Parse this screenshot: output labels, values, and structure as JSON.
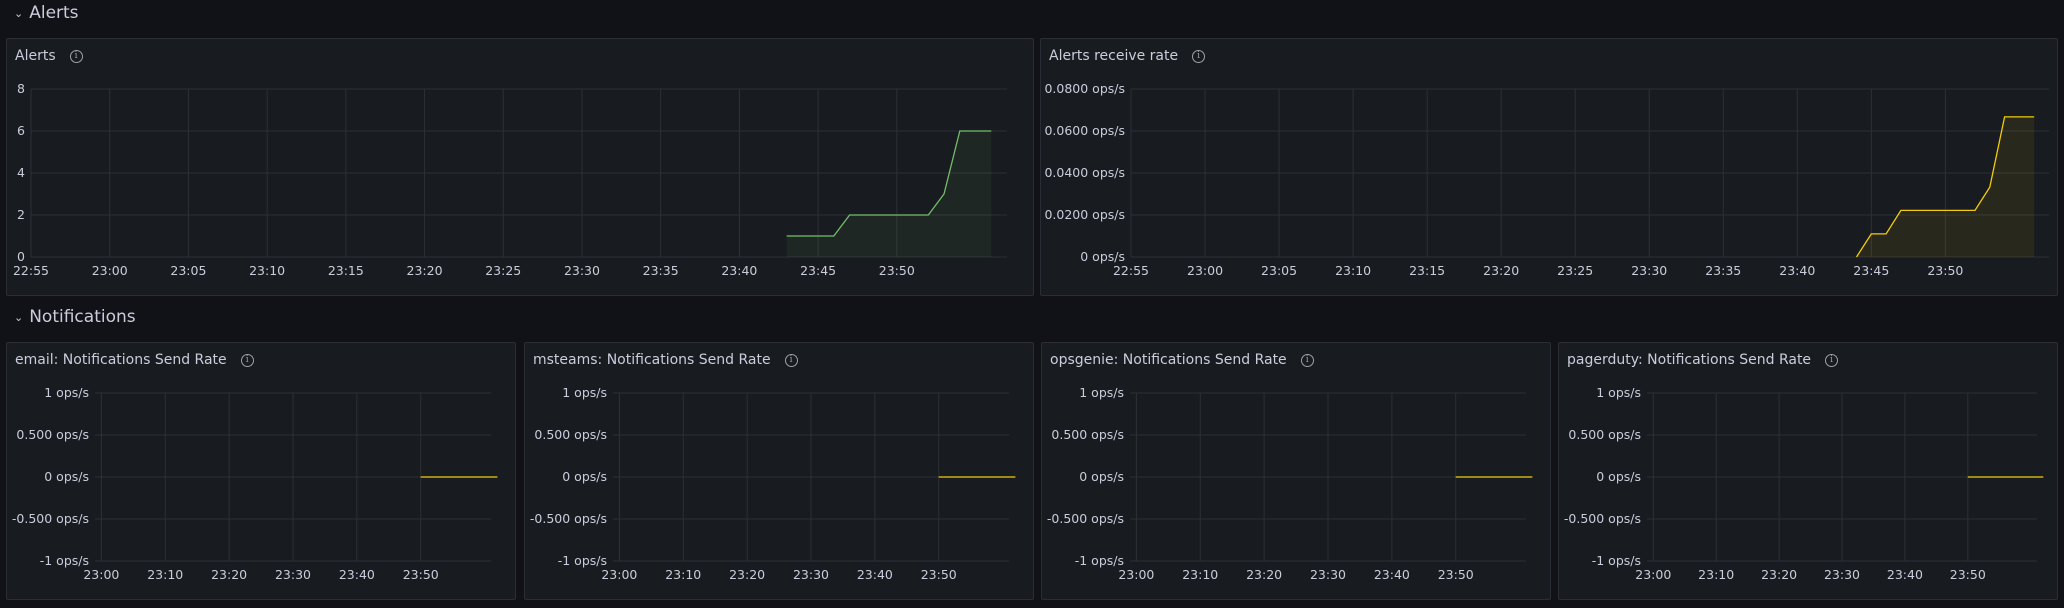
{
  "rows": {
    "alerts": {
      "label": "Alerts"
    },
    "notifications": {
      "label": "Notifications"
    }
  },
  "colors": {
    "green": "#73bf69",
    "yellow": "#f2cc0c",
    "grid": "#2d3038"
  },
  "panels": {
    "alerts": {
      "title": "Alerts",
      "chart_data": {
        "type": "area",
        "title": "Alerts",
        "y_ticks": [
          "0",
          "2",
          "4",
          "6",
          "8"
        ],
        "x_ticks": [
          "22:55",
          "23:00",
          "23:05",
          "23:10",
          "23:15",
          "23:20",
          "23:25",
          "23:30",
          "23:35",
          "23:40",
          "23:45",
          "23:50"
        ],
        "ylim": [
          0,
          8
        ],
        "series": [
          {
            "x": [
              "23:41",
              "23:42",
              "23:43",
              "23:44",
              "23:45",
              "23:46",
              "23:47",
              "23:48",
              "23:49",
              "23:50",
              "23:51",
              "23:52",
              "23:53",
              "23:54"
            ],
            "values": [
              1,
              1,
              1,
              1,
              2,
              2,
              2,
              2,
              2,
              2,
              3,
              6,
              6,
              6
            ],
            "color": "#73bf69"
          }
        ]
      }
    },
    "alerts_rate": {
      "title": "Alerts receive rate",
      "chart_data": {
        "type": "area",
        "title": "Alerts receive rate",
        "y_ticks": [
          "0 ops/s",
          "0.0200 ops/s",
          "0.0400 ops/s",
          "0.0600 ops/s",
          "0.0800 ops/s"
        ],
        "x_ticks": [
          "22:55",
          "23:00",
          "23:05",
          "23:10",
          "23:15",
          "23:20",
          "23:25",
          "23:30",
          "23:35",
          "23:40",
          "23:45",
          "23:50"
        ],
        "ylim": [
          0,
          0.08
        ],
        "series": [
          {
            "x": [
              "23:42",
              "23:43",
              "23:44",
              "23:45",
              "23:46",
              "23:47",
              "23:48",
              "23:49",
              "23:50",
              "23:51",
              "23:52",
              "23:53",
              "23:54"
            ],
            "values": [
              0,
              0.011,
              0.011,
              0.0222,
              0.0222,
              0.0222,
              0.0222,
              0.0222,
              0.0222,
              0.0333,
              0.0667,
              0.0667,
              0.0667
            ],
            "color": "#f2cc0c"
          }
        ]
      }
    },
    "email": {
      "title": "email: Notifications Send Rate",
      "chart_data": {
        "type": "line",
        "title": "email: Notifications Send Rate",
        "y_ticks": [
          "-1 ops/s",
          "-0.500 ops/s",
          "0 ops/s",
          "0.500 ops/s",
          "1 ops/s"
        ],
        "x_ticks": [
          "23:00",
          "23:10",
          "23:20",
          "23:30",
          "23:40",
          "23:50"
        ],
        "ylim": [
          -1,
          1
        ],
        "series": [
          {
            "x": [
              "23:42",
              "23:54"
            ],
            "values": [
              0,
              0
            ],
            "color": "#f2cc0c"
          }
        ]
      }
    },
    "msteams": {
      "title": "msteams: Notifications Send Rate",
      "chart_data": {
        "type": "line",
        "title": "msteams: Notifications Send Rate",
        "y_ticks": [
          "-1 ops/s",
          "-0.500 ops/s",
          "0 ops/s",
          "0.500 ops/s",
          "1 ops/s"
        ],
        "x_ticks": [
          "23:00",
          "23:10",
          "23:20",
          "23:30",
          "23:40",
          "23:50"
        ],
        "ylim": [
          -1,
          1
        ],
        "series": [
          {
            "x": [
              "23:42",
              "23:54"
            ],
            "values": [
              0,
              0
            ],
            "color": "#f2cc0c"
          }
        ]
      }
    },
    "opsgenie": {
      "title": "opsgenie: Notifications Send Rate",
      "chart_data": {
        "type": "line",
        "title": "opsgenie: Notifications Send Rate",
        "y_ticks": [
          "-1 ops/s",
          "-0.500 ops/s",
          "0 ops/s",
          "0.500 ops/s",
          "1 ops/s"
        ],
        "x_ticks": [
          "23:00",
          "23:10",
          "23:20",
          "23:30",
          "23:40",
          "23:50"
        ],
        "ylim": [
          -1,
          1
        ],
        "series": [
          {
            "x": [
              "23:42",
              "23:54"
            ],
            "values": [
              0,
              0
            ],
            "color": "#f2cc0c"
          }
        ]
      }
    },
    "pagerduty": {
      "title": "pagerduty: Notifications Send Rate",
      "chart_data": {
        "type": "line",
        "title": "pagerduty: Notifications Send Rate",
        "y_ticks": [
          "-1 ops/s",
          "-0.500 ops/s",
          "0 ops/s",
          "0.500 ops/s",
          "1 ops/s"
        ],
        "x_ticks": [
          "23:00",
          "23:10",
          "23:20",
          "23:30",
          "23:40",
          "23:50"
        ],
        "ylim": [
          -1,
          1
        ],
        "series": [
          {
            "x": [
              "23:42",
              "23:54"
            ],
            "values": [
              0,
              0
            ],
            "color": "#f2cc0c"
          }
        ]
      }
    }
  }
}
